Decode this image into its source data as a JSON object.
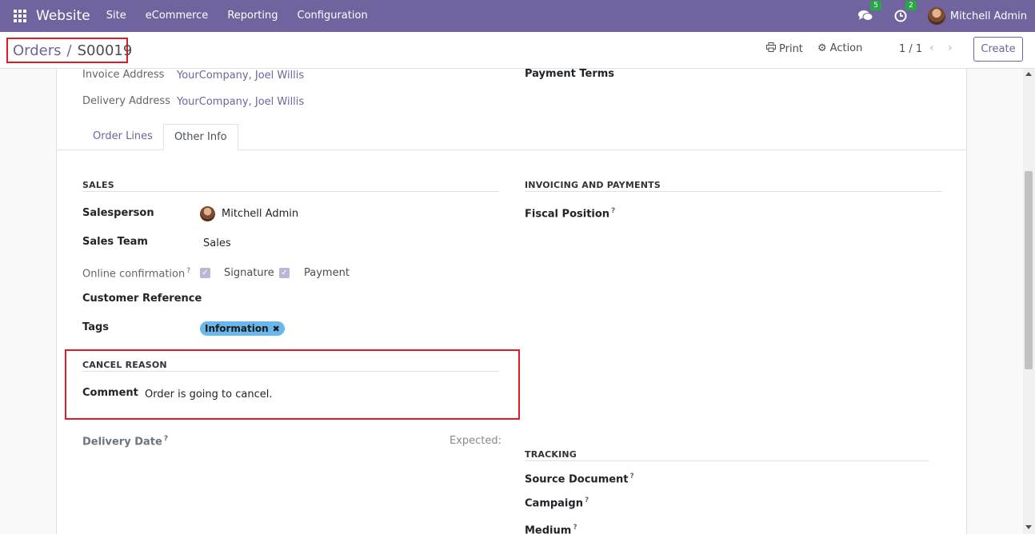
{
  "navbar": {
    "brand": "Website",
    "menu": [
      "Site",
      "eCommerce",
      "Reporting",
      "Configuration"
    ],
    "messages_count": "5",
    "activities_count": "2",
    "user_name": "Mitchell Admin"
  },
  "control_panel": {
    "breadcrumb_parent": "Orders",
    "breadcrumb_separator": "/",
    "breadcrumb_current": "S00019",
    "print_label": "Print",
    "action_label": "Action",
    "pager": "1 / 1",
    "create_label": "Create"
  },
  "header_fields": {
    "invoice_address_label": "Invoice Address",
    "invoice_address_value": "YourCompany, Joel Willis",
    "delivery_address_label": "Delivery Address",
    "delivery_address_value": "YourCompany, Joel Willis",
    "payment_terms_label": "Payment Terms"
  },
  "tabs": [
    "Order Lines",
    "Other Info"
  ],
  "sales": {
    "title": "SALES",
    "salesperson_label": "Salesperson",
    "salesperson_value": "Mitchell Admin",
    "sales_team_label": "Sales Team",
    "sales_team_value": "Sales",
    "online_confirmation_label": "Online confirmation",
    "signature_label": "Signature",
    "payment_label": "Payment",
    "customer_reference_label": "Customer Reference",
    "tags_label": "Tags",
    "tag_value": "Information"
  },
  "invoicing": {
    "title": "INVOICING AND PAYMENTS",
    "fiscal_position_label": "Fiscal Position"
  },
  "cancel_reason": {
    "title": "CANCEL REASON",
    "comment_label": "Comment",
    "comment_value": "Order is going to cancel."
  },
  "delivery": {
    "delivery_date_label": "Delivery Date",
    "expected_label": "Expected:"
  },
  "tracking": {
    "title": "TRACKING",
    "source_document_label": "Source Document",
    "campaign_label": "Campaign",
    "medium_label": "Medium"
  },
  "help_mark": "?",
  "colors": {
    "navbar": "#71639e",
    "highlight_border": "#e01b24",
    "tag": "#69b7eb",
    "badge": "#28a745"
  }
}
